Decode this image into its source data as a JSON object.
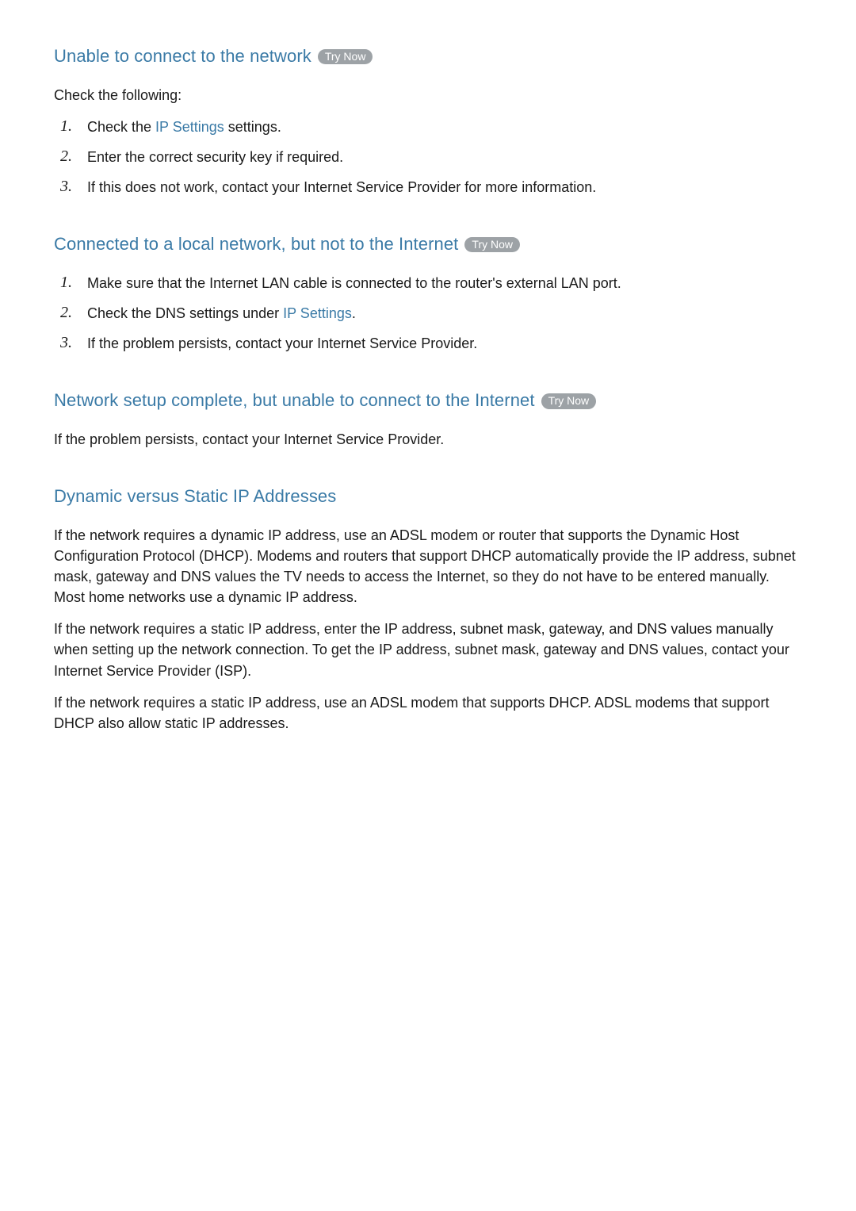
{
  "try_now_label": "Try Now",
  "sections": [
    {
      "heading": "Unable to connect to the network",
      "has_try_now": true,
      "intro": "Check the following:",
      "items": [
        {
          "pre": "Check the ",
          "link": "IP Settings",
          "post": " settings."
        },
        {
          "pre": "Enter the correct security key if required.",
          "link": "",
          "post": ""
        },
        {
          "pre": "If this does not work, contact your Internet Service Provider for more information.",
          "link": "",
          "post": ""
        }
      ]
    },
    {
      "heading": "Connected to a local network, but not to the Internet",
      "has_try_now": true,
      "items": [
        {
          "pre": "Make sure that the Internet LAN cable is connected to the router's external LAN port.",
          "link": "",
          "post": ""
        },
        {
          "pre": "Check the DNS settings under ",
          "link": "IP Settings",
          "post": "."
        },
        {
          "pre": "If the problem persists, contact your Internet Service Provider.",
          "link": "",
          "post": ""
        }
      ]
    },
    {
      "heading": "Network setup complete, but unable to connect to the Internet",
      "has_try_now": true,
      "paragraphs": [
        "If the problem persists, contact your Internet Service Provider."
      ]
    },
    {
      "heading": "Dynamic versus Static IP Addresses",
      "has_try_now": false,
      "paragraphs": [
        "If the network requires a dynamic IP address, use an ADSL modem or router that supports the Dynamic Host Configuration Protocol (DHCP). Modems and routers that support DHCP automatically provide the IP address, subnet mask, gateway and DNS values the TV needs to access the Internet, so they do not have to be entered manually. Most home networks use a dynamic IP address.",
        "If the network requires a static IP address, enter the IP address, subnet mask, gateway, and DNS values manually when setting up the network connection. To get the IP address, subnet mask, gateway and DNS values, contact your Internet Service Provider (ISP).",
        "If the network requires a static IP address, use an ADSL modem that supports DHCP. ADSL modems that support DHCP also allow static IP addresses."
      ]
    }
  ]
}
